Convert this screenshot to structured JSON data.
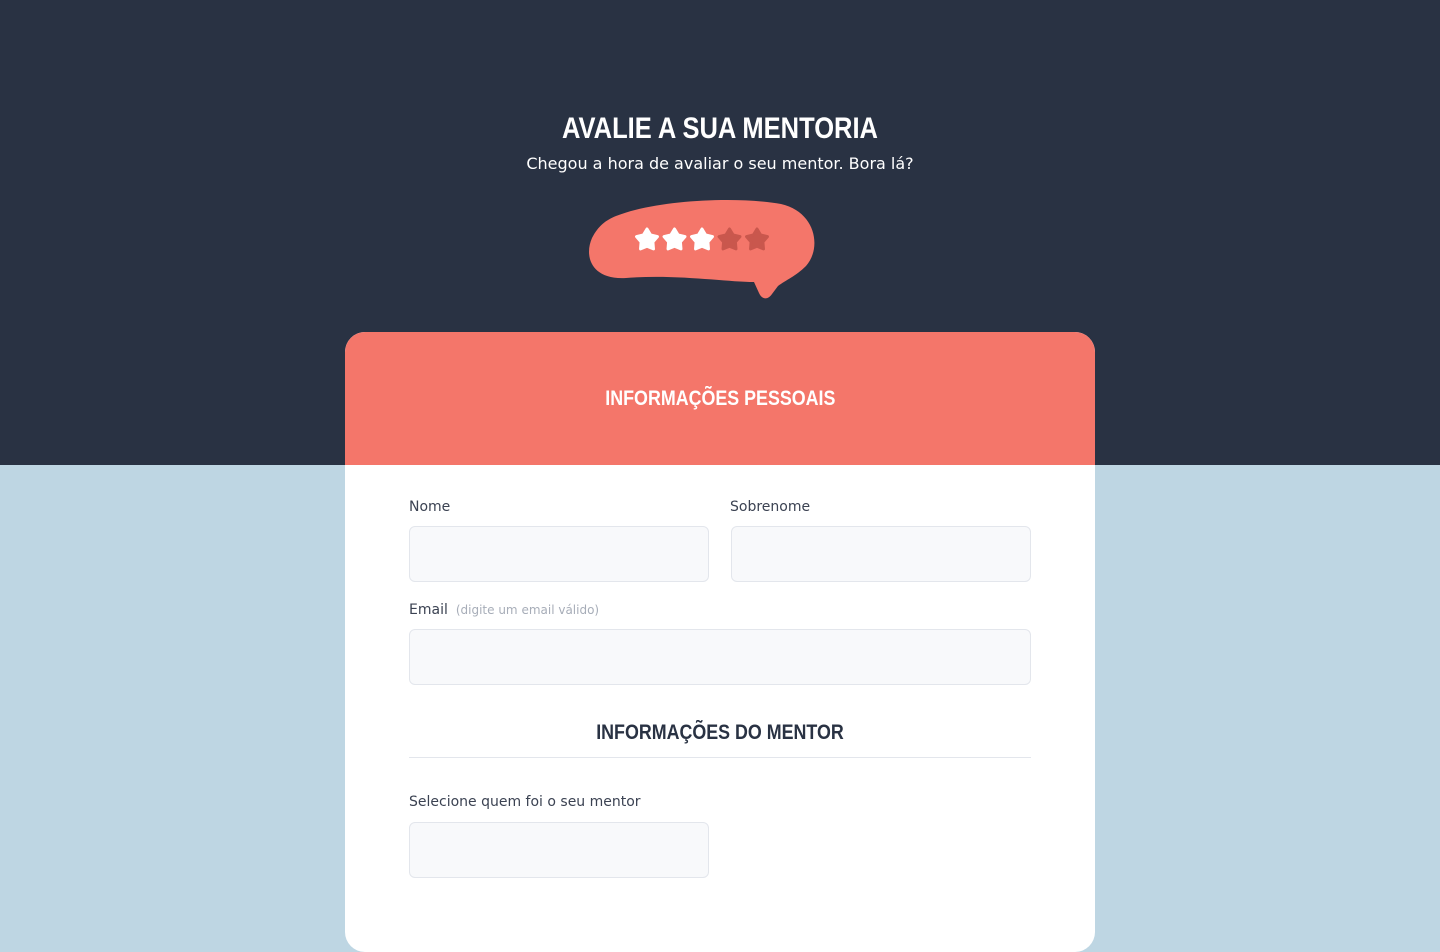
{
  "header": {
    "title": "AVALIE A SUA MENTORIA",
    "subtitle": "Chegou a hora de avaliar o seu mentor. Bora lá?"
  },
  "rating": {
    "filled_stars": 3,
    "total_stars": 5,
    "bubble_color": "#f4766a",
    "filled_color": "#ffffff",
    "empty_color": "#c9574d",
    "icon": "star-icon"
  },
  "form": {
    "section_personal": "INFORMAÇÕES PESSOAIS",
    "first_name": {
      "label": "Nome",
      "value": "",
      "placeholder": ""
    },
    "last_name": {
      "label": "Sobrenome",
      "value": "",
      "placeholder": ""
    },
    "email": {
      "label": "Email",
      "hint": "(digite um email válido)",
      "value": "",
      "placeholder": ""
    },
    "section_mentor": "INFORMAÇÕES DO MENTOR",
    "mentor_select": {
      "label": "Selecione quem foi o seu mentor",
      "value": ""
    }
  },
  "colors": {
    "top_background": "#293243",
    "bottom_background": "#bed6e3",
    "accent": "#f4766a",
    "heading_dark": "#293243"
  }
}
